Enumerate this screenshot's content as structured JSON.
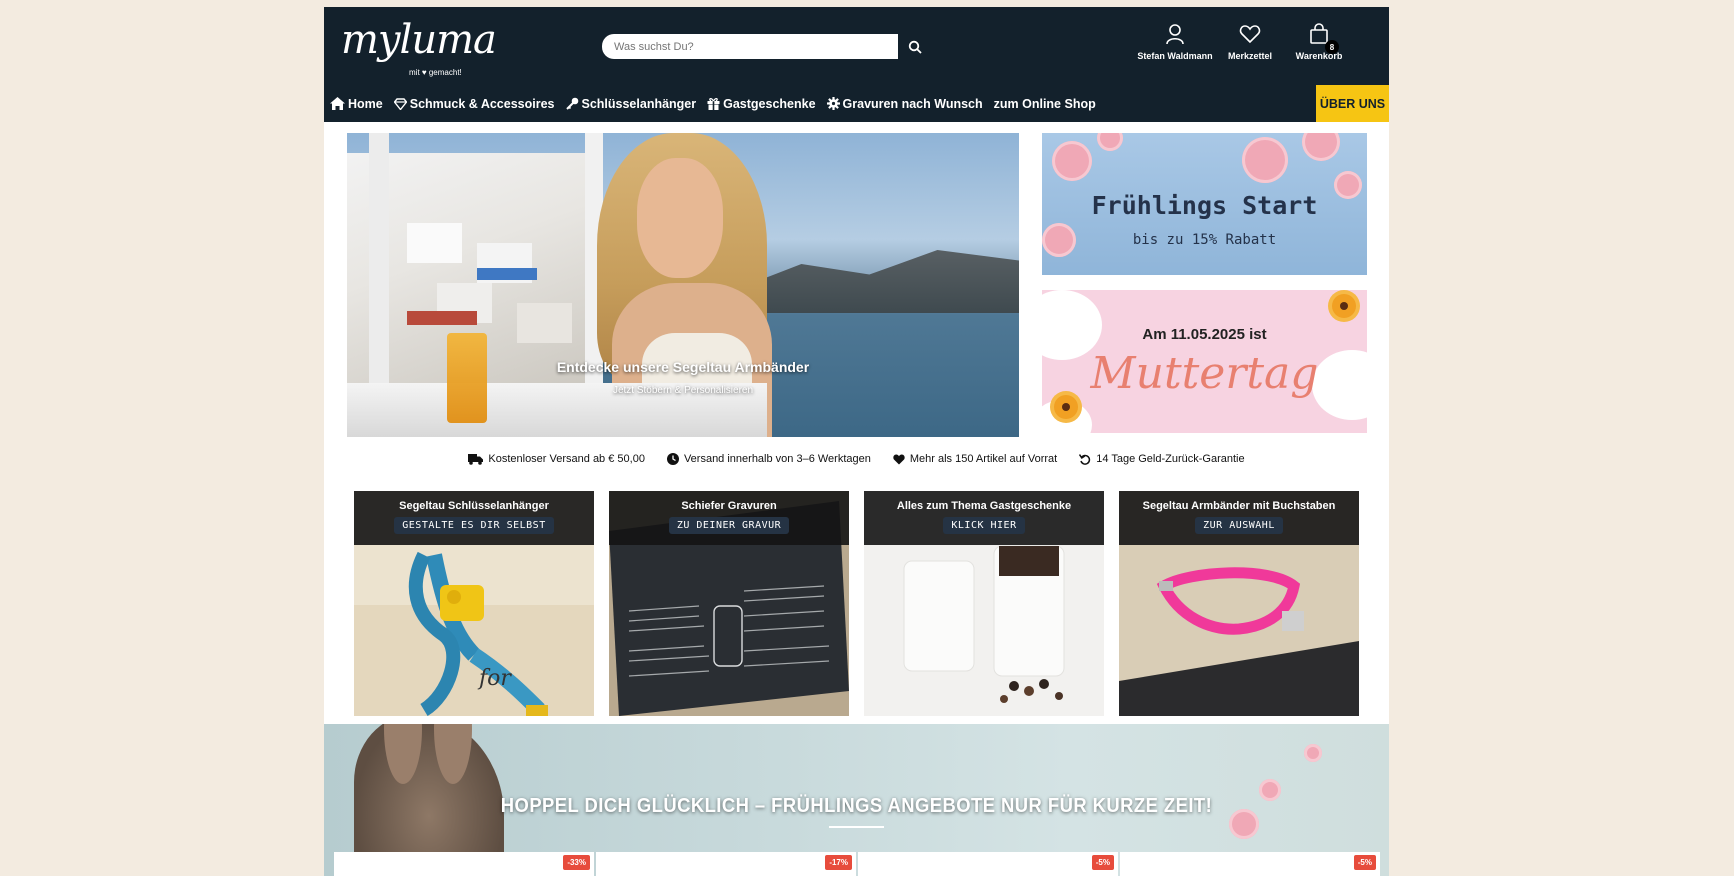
{
  "header": {
    "logo_word": "myluma",
    "logo_tagline": "mit ♥ gemacht!",
    "search_placeholder": "Was suchst Du?",
    "account_label": "Stefan Waldmann",
    "wishlist_label": "Merkzettel",
    "cart_label": "Warenkorb",
    "cart_count": "8"
  },
  "nav": {
    "items": [
      {
        "label": "Home",
        "icon": "home-icon"
      },
      {
        "label": "Schmuck & Accessoires",
        "icon": "diamond-icon"
      },
      {
        "label": "Schlüsselanhänger",
        "icon": "key-icon"
      },
      {
        "label": "Gastgeschenke",
        "icon": "gift-icon"
      },
      {
        "label": "Gravuren nach Wunsch",
        "icon": "gear-icon"
      },
      {
        "label": "zum Online Shop",
        "icon": ""
      }
    ],
    "highlight": "ÜBER UNS",
    "highlight_color": "#f6c513"
  },
  "hero": {
    "title": "Entdecke unsere Segeltau Armbänder",
    "subtitle": "Jetzt Stöbern & Personalisieren"
  },
  "promos": {
    "spring": {
      "title": "Frühlings Start",
      "subtitle": "bis zu 15% Rabatt"
    },
    "mothers_day": {
      "title": "Am 11.05.2025 ist",
      "big": "Muttertag"
    }
  },
  "usp": [
    {
      "icon": "truck-icon",
      "text": "Kostenloser Versand ab € 50,00"
    },
    {
      "icon": "clock-icon",
      "text": "Versand innerhalb von 3–6 Werktagen"
    },
    {
      "icon": "heart-icon",
      "text": "Mehr als 150 Artikel auf Vorrat"
    },
    {
      "icon": "undo-icon",
      "text": "14 Tage Geld-Zurück-Garantie"
    }
  ],
  "tiles": [
    {
      "title": "Segeltau Schlüsselanhänger",
      "cta": "GESTALTE ES DIR SELBST"
    },
    {
      "title": "Schiefer Gravuren",
      "cta": "ZU DEINER GRAVUR"
    },
    {
      "title": "Alles zum Thema Gastgeschenke",
      "cta": "KLICK HIER"
    },
    {
      "title": "Segeltau Armbänder mit Buchstaben",
      "cta": "ZUR AUSWAHL"
    }
  ],
  "spring_banner": {
    "title": "HOPPEL DICH GLÜCKLICH – FRÜHLINGS ANGEBOTE NUR FÜR KURZE ZEIT!",
    "badges": [
      "-33%",
      "-17%",
      "-5%",
      "-5%"
    ]
  },
  "colors": {
    "header_bg": "#13212c",
    "page_bg": "#f3ebe0",
    "sale_badge": "#e74c3c"
  }
}
